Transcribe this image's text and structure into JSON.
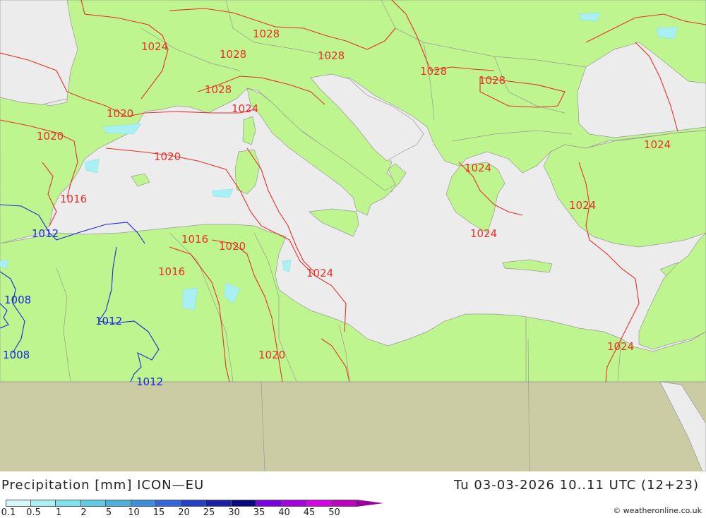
{
  "title": "Precipitation [mm] ICON—EU",
  "valid_time": "Tu 03-03-2026 10..11 UTC (12+23)",
  "credit": "© weatheronline.co.uk",
  "colors": {
    "sea": "#ececec",
    "land": "#bff58f",
    "outside_domain": "#cccca4",
    "isobar_high": "#e8312a",
    "isobar_low": "#1a2ad6"
  },
  "legend": {
    "labels": [
      "0.1",
      "0.5",
      "1",
      "2",
      "5",
      "10",
      "15",
      "20",
      "25",
      "30",
      "35",
      "40",
      "45",
      "50"
    ],
    "colors": [
      "#d4f8fa",
      "#a8f0f4",
      "#7ee2ee",
      "#5ecce6",
      "#4ab0dc",
      "#3c8ede",
      "#2f66e0",
      "#2240c8",
      "#1a20a8",
      "#0a0a80",
      "#7a00e6",
      "#a800e6",
      "#d800e6",
      "#c000c0"
    ]
  },
  "isobar_labels": [
    {
      "text": "1024",
      "kind": "high"
    },
    {
      "text": "1028",
      "kind": "high"
    },
    {
      "text": "1028",
      "kind": "high"
    },
    {
      "text": "1028",
      "kind": "high"
    },
    {
      "text": "1028",
      "kind": "high"
    },
    {
      "text": "1028",
      "kind": "high"
    },
    {
      "text": "1028",
      "kind": "high"
    },
    {
      "text": "1020",
      "kind": "high"
    },
    {
      "text": "1024",
      "kind": "high"
    },
    {
      "text": "1020",
      "kind": "high"
    },
    {
      "text": "1020",
      "kind": "high"
    },
    {
      "text": "1024",
      "kind": "high"
    },
    {
      "text": "1024",
      "kind": "high"
    },
    {
      "text": "1016",
      "kind": "high"
    },
    {
      "text": "1024",
      "kind": "high"
    },
    {
      "text": "1024",
      "kind": "high"
    },
    {
      "text": "1016",
      "kind": "high"
    },
    {
      "text": "1020",
      "kind": "high"
    },
    {
      "text": "1016",
      "kind": "high"
    },
    {
      "text": "1024",
      "kind": "high"
    },
    {
      "text": "1020",
      "kind": "high"
    },
    {
      "text": "1024",
      "kind": "high"
    },
    {
      "text": "1012",
      "kind": "low"
    },
    {
      "text": "1008",
      "kind": "low"
    },
    {
      "text": "1012",
      "kind": "low"
    },
    {
      "text": "1008",
      "kind": "low"
    },
    {
      "text": "1012",
      "kind": "low"
    }
  ]
}
